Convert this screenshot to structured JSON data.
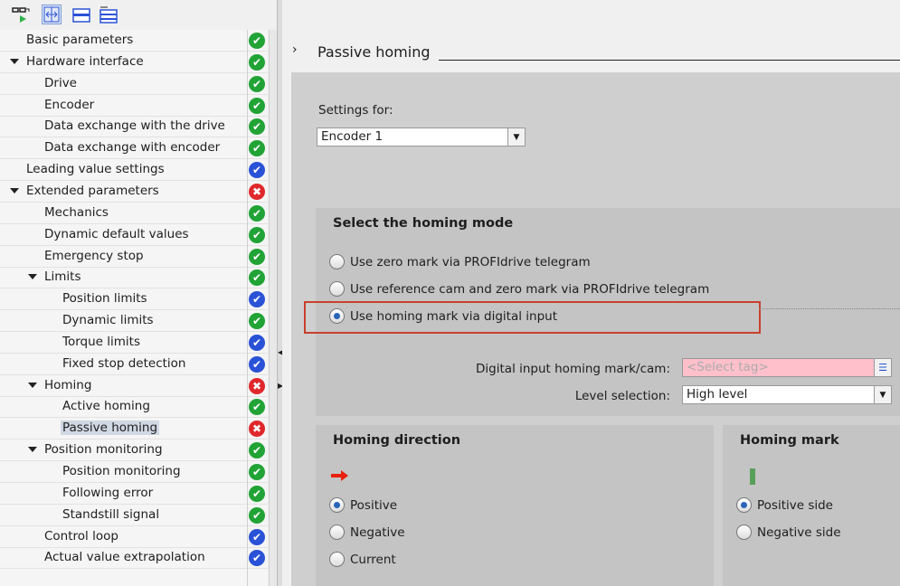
{
  "toolbar": {
    "icons": [
      "glasses-run-icon",
      "fit-width-icon",
      "folder-icon",
      "folder-tree-icon"
    ]
  },
  "colors": {
    "ok": "#21a336",
    "info": "#2a52d6",
    "error": "#e0282c",
    "highlight": "#c8402c",
    "invalid_field": "#ffc0cb"
  },
  "tree": [
    {
      "label": "Basic parameters",
      "level": 0,
      "status": "ok"
    },
    {
      "label": "Hardware interface",
      "level": 0,
      "expanded": true,
      "status": "ok"
    },
    {
      "label": "Drive",
      "level": 1,
      "status": "ok"
    },
    {
      "label": "Encoder",
      "level": 1,
      "status": "ok"
    },
    {
      "label": "Data exchange with the drive",
      "level": 1,
      "status": "ok"
    },
    {
      "label": "Data exchange with encoder",
      "level": 1,
      "status": "ok"
    },
    {
      "label": "Leading value settings",
      "level": 0,
      "status": "info"
    },
    {
      "label": "Extended parameters",
      "level": 0,
      "expanded": true,
      "status": "error"
    },
    {
      "label": "Mechanics",
      "level": 1,
      "status": "ok"
    },
    {
      "label": "Dynamic default values",
      "level": 1,
      "status": "ok"
    },
    {
      "label": "Emergency stop",
      "level": 1,
      "status": "ok"
    },
    {
      "label": "Limits",
      "level": 1,
      "expanded": true,
      "status": "ok"
    },
    {
      "label": "Position limits",
      "level": 2,
      "status": "info"
    },
    {
      "label": "Dynamic limits",
      "level": 2,
      "status": "ok"
    },
    {
      "label": "Torque limits",
      "level": 2,
      "status": "info"
    },
    {
      "label": "Fixed stop detection",
      "level": 2,
      "status": "info"
    },
    {
      "label": "Homing",
      "level": 1,
      "expanded": true,
      "status": "error"
    },
    {
      "label": "Active homing",
      "level": 2,
      "status": "ok"
    },
    {
      "label": "Passive homing",
      "level": 2,
      "status": "error",
      "selected": true
    },
    {
      "label": "Position monitoring",
      "level": 1,
      "expanded": true,
      "status": "ok"
    },
    {
      "label": "Position monitoring",
      "level": 2,
      "status": "ok"
    },
    {
      "label": "Following error",
      "level": 2,
      "status": "ok"
    },
    {
      "label": "Standstill signal",
      "level": 2,
      "status": "ok"
    },
    {
      "label": "Control loop",
      "level": 1,
      "status": "info"
    },
    {
      "label": "Actual value extrapolation",
      "level": 1,
      "status": "info"
    }
  ],
  "header": {
    "chevron": "›",
    "title": "Passive homing"
  },
  "settings": {
    "label": "Settings for:",
    "value": "Encoder 1"
  },
  "mode": {
    "title": "Select the homing mode",
    "options": [
      "Use zero mark via PROFIdrive telegram",
      "Use reference cam and zero mark via PROFIdrive telegram",
      "Use homing mark via digital input"
    ],
    "selected": 2,
    "digital_input_label": "Digital input homing mark/cam:",
    "digital_input_placeholder": "<Select tag>",
    "level_label": "Level selection:",
    "level_value": "High level"
  },
  "direction": {
    "title": "Homing direction",
    "options": [
      "Positive",
      "Negative",
      "Current"
    ],
    "selected": 0
  },
  "mark": {
    "title": "Homing mark",
    "options": [
      "Positive side",
      "Negative side"
    ],
    "selected": 0
  }
}
